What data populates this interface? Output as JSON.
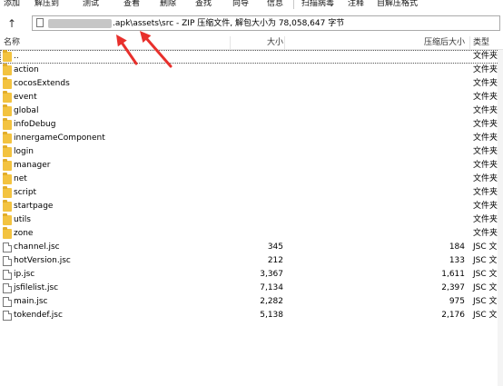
{
  "toolbar": {
    "buttons": [
      "添加",
      "解压到",
      "测试",
      "查看",
      "删除",
      "查找",
      "向导",
      "信息",
      "扫描病毒",
      "注释",
      "自解压格式"
    ]
  },
  "address": {
    "path_text": ".apk\\assets\\src - ZIP 压缩文件, 解包大小为 78,058,647 字节"
  },
  "columns": {
    "name": "名称",
    "size": "大小",
    "packed": "压缩后大小",
    "type": "类型"
  },
  "files": [
    {
      "name": "..",
      "kind": "folder",
      "size": "",
      "packed": "",
      "type": "文件夹"
    },
    {
      "name": "action",
      "kind": "folder",
      "size": "",
      "packed": "",
      "type": "文件夹"
    },
    {
      "name": "cocosExtends",
      "kind": "folder",
      "size": "",
      "packed": "",
      "type": "文件夹"
    },
    {
      "name": "event",
      "kind": "folder",
      "size": "",
      "packed": "",
      "type": "文件夹"
    },
    {
      "name": "global",
      "kind": "folder",
      "size": "",
      "packed": "",
      "type": "文件夹"
    },
    {
      "name": "infoDebug",
      "kind": "folder",
      "size": "",
      "packed": "",
      "type": "文件夹"
    },
    {
      "name": "innergameComponent",
      "kind": "folder",
      "size": "",
      "packed": "",
      "type": "文件夹"
    },
    {
      "name": "login",
      "kind": "folder",
      "size": "",
      "packed": "",
      "type": "文件夹"
    },
    {
      "name": "manager",
      "kind": "folder",
      "size": "",
      "packed": "",
      "type": "文件夹"
    },
    {
      "name": "net",
      "kind": "folder",
      "size": "",
      "packed": "",
      "type": "文件夹"
    },
    {
      "name": "script",
      "kind": "folder",
      "size": "",
      "packed": "",
      "type": "文件夹"
    },
    {
      "name": "startpage",
      "kind": "folder",
      "size": "",
      "packed": "",
      "type": "文件夹"
    },
    {
      "name": "utils",
      "kind": "folder",
      "size": "",
      "packed": "",
      "type": "文件夹"
    },
    {
      "name": "zone",
      "kind": "folder",
      "size": "",
      "packed": "",
      "type": "文件夹"
    },
    {
      "name": "channel.jsc",
      "kind": "file",
      "size": "345",
      "packed": "184",
      "type": "JSC 文件"
    },
    {
      "name": "hotVersion.jsc",
      "kind": "file",
      "size": "212",
      "packed": "133",
      "type": "JSC 文件"
    },
    {
      "name": "ip.jsc",
      "kind": "file",
      "size": "3,367",
      "packed": "1,611",
      "type": "JSC 文件"
    },
    {
      "name": "jsfilelist.jsc",
      "kind": "file",
      "size": "7,134",
      "packed": "2,397",
      "type": "JSC 文件"
    },
    {
      "name": "main.jsc",
      "kind": "file",
      "size": "2,282",
      "packed": "975",
      "type": "JSC 文件"
    },
    {
      "name": "tokendef.jsc",
      "kind": "file",
      "size": "5,138",
      "packed": "2,176",
      "type": "JSC 文件"
    }
  ],
  "colors": {
    "annotation_arrow": "#e8302c",
    "folder": "#f3c340"
  }
}
